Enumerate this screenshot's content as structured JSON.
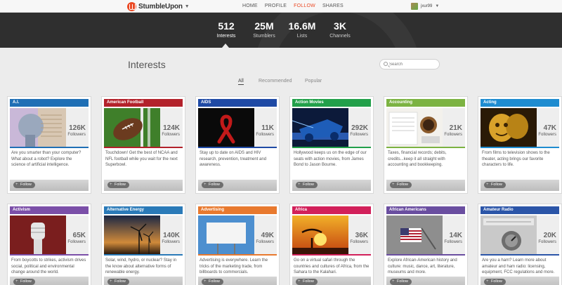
{
  "brand": {
    "name": "StumbleUpon"
  },
  "nav": {
    "items": [
      "HOME",
      "PROFILE",
      "FOLLOW",
      "SHARES"
    ],
    "active": "FOLLOW"
  },
  "user": {
    "name": "jxur99"
  },
  "stats": [
    {
      "value": "512",
      "label": "Interests"
    },
    {
      "value": "25M",
      "label": "Stumblers"
    },
    {
      "value": "16.6M",
      "label": "Lists"
    },
    {
      "value": "3K",
      "label": "Channels"
    }
  ],
  "page": {
    "title": "Interests"
  },
  "search": {
    "placeholder": "Search"
  },
  "tabs": [
    "All",
    "Recommended",
    "Popular"
  ],
  "follow_label": "Follow",
  "followers_label": "Followers",
  "cards": [
    {
      "title": "A.I.",
      "count": "126K",
      "color": "#1f6fb5",
      "desc": "Are you smarter than your computer? What about a robot? Explore the science of artificial intelligence."
    },
    {
      "title": "American Football",
      "count": "124K",
      "color": "#b3222b",
      "desc": "Touchdown! Get the best of NCAA and NFL football while you wait for the next Superbowl."
    },
    {
      "title": "AIDS",
      "count": "11K",
      "color": "#1f4aa5",
      "desc": "Stay up to date on AIDS and HIV research, prevention, treatment and awareness."
    },
    {
      "title": "Action Movies",
      "count": "292K",
      "color": "#22a04a",
      "desc": "Hollywood keeps us on the edge of our seats with action movies, from James Bond to Jason Bourne."
    },
    {
      "title": "Accounting",
      "count": "21K",
      "color": "#7cb342",
      "desc": "Taxes, financial records; debits, credits...keep it all straight with accounting and bookkeeping."
    },
    {
      "title": "Acting",
      "count": "47K",
      "color": "#1e8cd0",
      "desc": "From films to television shows to the theater, acting brings our favorite characters to life."
    },
    {
      "title": "Activism",
      "count": "65K",
      "color": "#7b4fa8",
      "desc": "From boycotts to strikes, activism drives social, political and environmental change around the world."
    },
    {
      "title": "Alternative Energy",
      "count": "140K",
      "color": "#2a7ab8",
      "desc": "Solar, wind, hydro, or nuclear? Stay in the know about alternative forms of renewable energy."
    },
    {
      "title": "Advertising",
      "count": "49K",
      "color": "#e8792e",
      "desc": "Advertising is everywhere. Learn the tricks of the marketing trade, from billboards to commercials."
    },
    {
      "title": "Africa",
      "count": "36K",
      "color": "#d2205a",
      "desc": "Go on a virtual safari through the countries and cultures of Africa, from the Sahara to the Kalahari."
    },
    {
      "title": "African Americans",
      "count": "14K",
      "color": "#6a4ea0",
      "desc": "Explore African-American history and culture: music, dance, art, literature, museums and more."
    },
    {
      "title": "Amateur Radio",
      "count": "20K",
      "color": "#2b55a8",
      "desc": "Are you a ham? Learn more about amateur and ham radio: licensing, equipment, FCC regulations and more."
    }
  ]
}
